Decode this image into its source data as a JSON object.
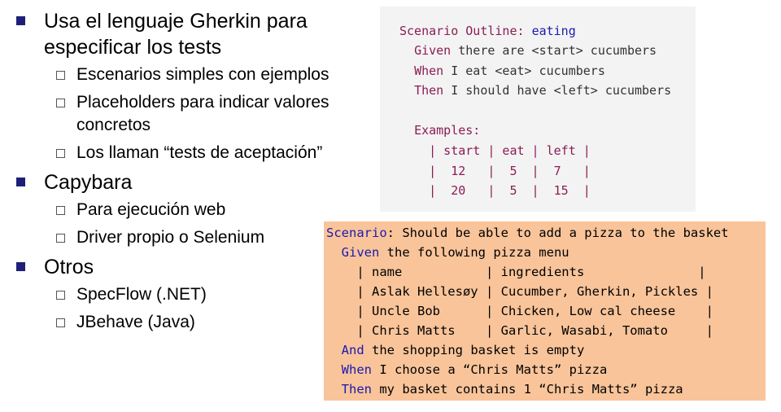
{
  "bullets": [
    {
      "text": "Usa el lenguaje Gherkin para especificar los tests",
      "sub": [
        "Escenarios simples con ejemplos",
        "Placeholders para indicar valores concretos",
        "Los llaman “tests de aceptación”"
      ]
    },
    {
      "text": "Capybara",
      "sub": [
        "Para ejecución web",
        "Driver propio o Selenium"
      ]
    },
    {
      "text": "Otros",
      "sub": [
        "SpecFlow (.NET)",
        "JBehave (Java)"
      ]
    }
  ],
  "outline": {
    "title_kw": "Scenario Outline:",
    "title_name": "eating",
    "given_kw": "Given",
    "given_text": " there are <start> cucumbers",
    "when_kw": "When",
    "when_text": " I eat <eat> cucumbers",
    "then_kw": "Then",
    "then_text": " I should have <left> cucumbers",
    "examples_kw": "Examples:",
    "table": [
      "| start | eat | left |",
      "|  12   |  5  |  7   |",
      "|  20   |  5  |  15  |"
    ]
  },
  "scenario": {
    "title_kw": "Scenario",
    "title_text": ": Should be able to add a pizza to the basket",
    "given_kw": "Given",
    "given_text": " the following pizza menu",
    "table": [
      "| name           | ingredients               |",
      "| Aslak Hellesøy | Cucumber, Gherkin, Pickles |",
      "| Uncle Bob      | Chicken, Low cal cheese    |",
      "| Chris Matts    | Garlic, Wasabi, Tomato     |"
    ],
    "and_kw": "And",
    "and_text": " the shopping basket is empty",
    "when_kw": "When",
    "when_text": " I choose a “Chris Matts” pizza",
    "then_kw": "Then",
    "then_text": " my basket contains 1 “Chris Matts” pizza"
  }
}
